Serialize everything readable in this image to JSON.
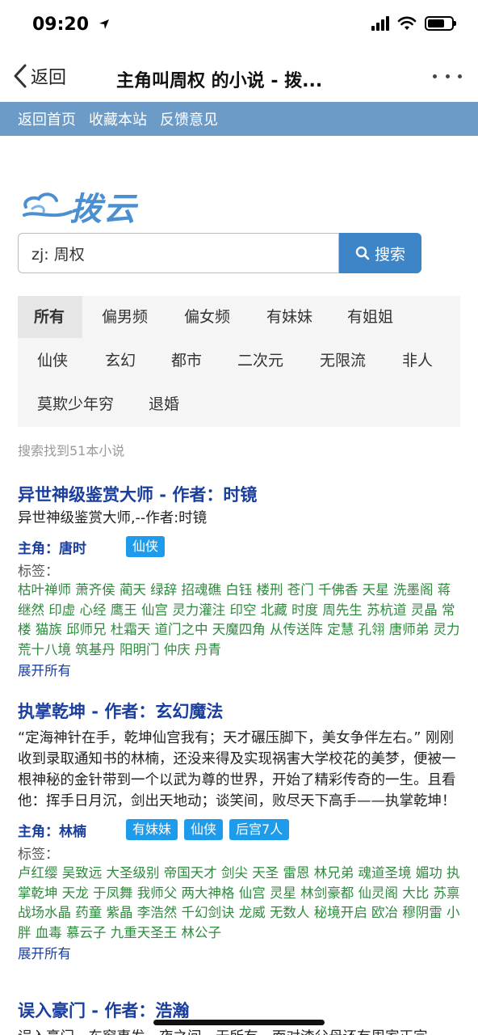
{
  "status": {
    "time": "09:20"
  },
  "nav": {
    "back_label": "返回",
    "title": "主角叫周权 的小说 - 拨..."
  },
  "top_links": [
    "返回首页",
    "收藏本站",
    "反馈意见"
  ],
  "logo": {
    "text": "拨云"
  },
  "search": {
    "value": "zj: 周权",
    "button_label": "搜索"
  },
  "categories": {
    "row1": [
      "所有",
      "偏男频",
      "偏女频",
      "有妹妹",
      "有姐姐"
    ],
    "row2": [
      "仙侠",
      "玄幻",
      "都市",
      "二次元",
      "无限流",
      "非人"
    ],
    "row3": [
      "莫欺少年穷",
      "退婚"
    ],
    "active": "所有"
  },
  "result_count": "搜索找到51本小说",
  "books": [
    {
      "title": "异世神级鉴赏大师 - 作者：时镜",
      "desc": "异世神级鉴赏大师,--作者:时镜",
      "protagonist": "主角：唐时",
      "badges": [
        "仙侠"
      ],
      "tag_label": "标签：",
      "tags": "枯叶禅师 萧齐侯 蔺天 绿辞 招魂礁 白钰 楼刑 苍门 千佛香 天星 洗墨阁 蒋继然 印虚 心经 鹰王 仙宫 灵力灌注 印空 北藏 时度 周先生 苏杭道 灵晶 常楼 猫族 邱师兄 杜霜天 道门之中 天魔四角 从传送阵 定慧 孔翎 唐师弟 灵力 荒十八境 筑基丹 阳明门 仲庆 丹青",
      "expand": "展开所有"
    },
    {
      "title": "执掌乾坤 - 作者：玄幻魔法",
      "desc": "“定海神针在手，乾坤仙宫我有；天才碾压脚下，美女争伴左右。” 刚刚收到录取通知书的林楠，还没来得及实现祸害大学校花的美梦，便被一根神秘的金针带到一个以武为尊的世界，开始了精彩传奇的一生。且看他：挥手日月沉，剑出天地动；谈笑间，败尽天下高手——执掌乾坤！",
      "protagonist": "主角：林楠",
      "badges": [
        "有妹妹",
        "仙侠",
        "后宫7人"
      ],
      "tag_label": "标签：",
      "tags": "卢红缨 吴致远 大圣级别 帝国天才 剑尖 天圣 雷恩 林兄弟 魂道圣境 媚功 执掌乾坤 天龙 于凤舞 我师父 两大神格 仙宫 灵星 林剑豪都 仙灵阁 大比 苏禀 战场水晶 药童 紫晶 李浩然 千幻剑诀 龙威 无数人 秘境开启 欧冶 穆阴雷 小胖 血毒 慕云子 九重天圣王 林公子",
      "expand": "展开所有"
    },
    {
      "title": "误入豪门 - 作者：浩瀚",
      "desc": "误入豪门，东窗事发一夜之间一无所有，面对渣父母还有周家正宗"
    }
  ]
}
